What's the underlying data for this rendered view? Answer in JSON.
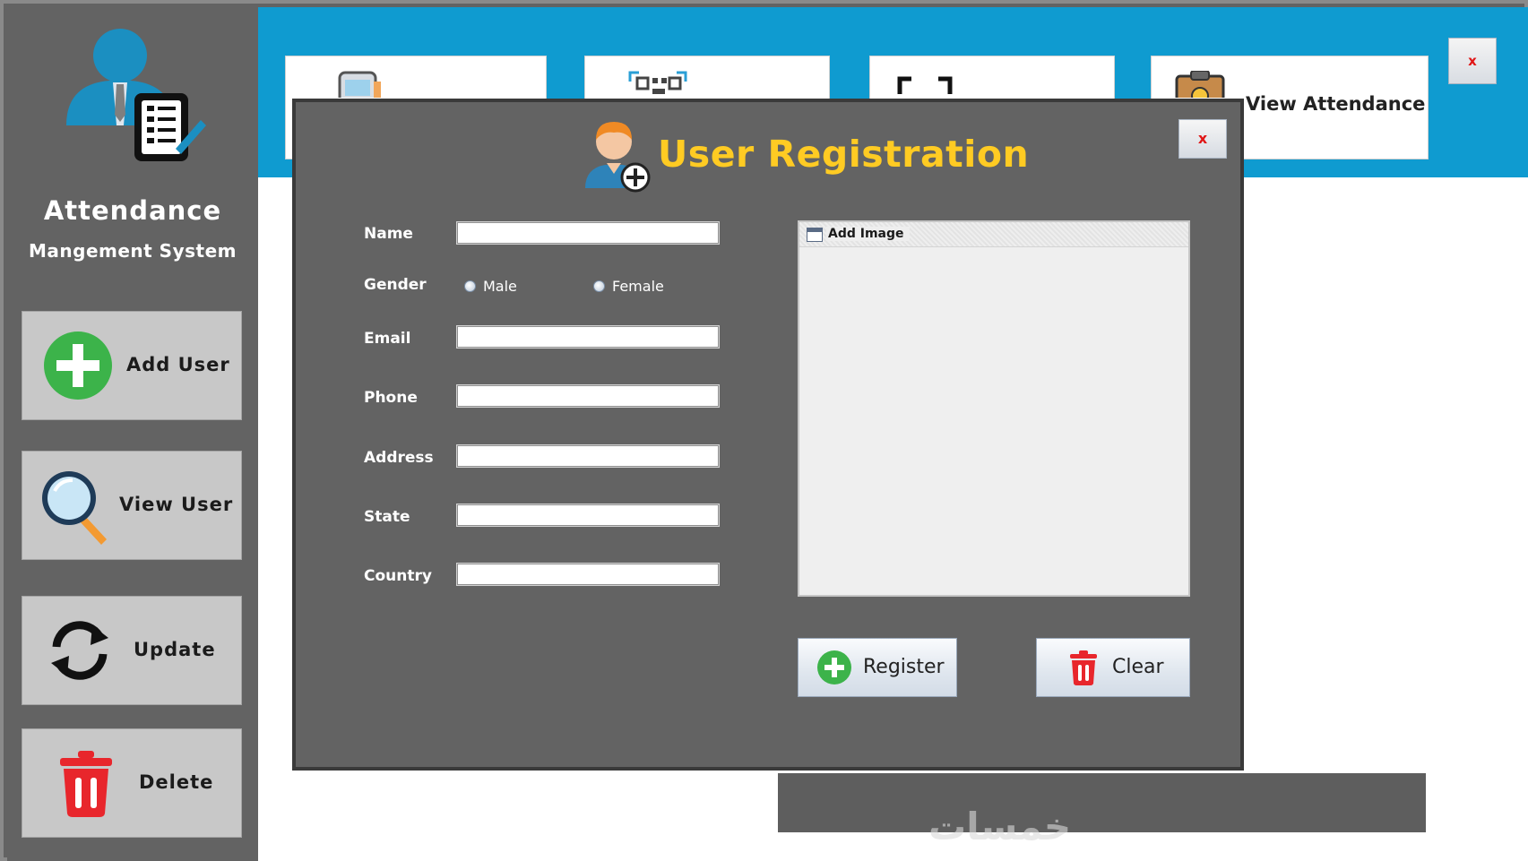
{
  "sidebar": {
    "brand_title": "Attendance",
    "brand_subtitle": "Mangement System",
    "items": [
      {
        "label": "Add User",
        "icon": "plus-circle-icon"
      },
      {
        "label": "View User",
        "icon": "magnifier-icon"
      },
      {
        "label": "Update",
        "icon": "refresh-icon"
      },
      {
        "label": "Delete",
        "icon": "trash-icon"
      }
    ]
  },
  "topbar": {
    "cards": [
      {
        "icon": "phone-scan-icon"
      },
      {
        "icon": "qr-code-icon"
      },
      {
        "icon": "scan-frame-icon"
      },
      {
        "icon": "clipboard-check-icon",
        "label": "View Attendance"
      }
    ],
    "close_label": "x"
  },
  "dialog": {
    "title": "User Registration",
    "close_label": "x",
    "fields": {
      "name": {
        "label": "Name",
        "value": ""
      },
      "gender": {
        "label": "Gender",
        "options": [
          "Male",
          "Female"
        ]
      },
      "email": {
        "label": "Email",
        "value": ""
      },
      "phone": {
        "label": "Phone",
        "value": ""
      },
      "address": {
        "label": "Address",
        "value": ""
      },
      "state": {
        "label": "State",
        "value": ""
      },
      "country": {
        "label": "Country",
        "value": ""
      }
    },
    "image_panel": {
      "title": "Add Image"
    },
    "register_label": "Register",
    "clear_label": "Clear"
  },
  "watermark": "خمسات",
  "colors": {
    "accent_blue": "#0f9bd0",
    "title_yellow": "#ffcb23",
    "panel_gray": "#636363",
    "close_red": "#e01515"
  }
}
